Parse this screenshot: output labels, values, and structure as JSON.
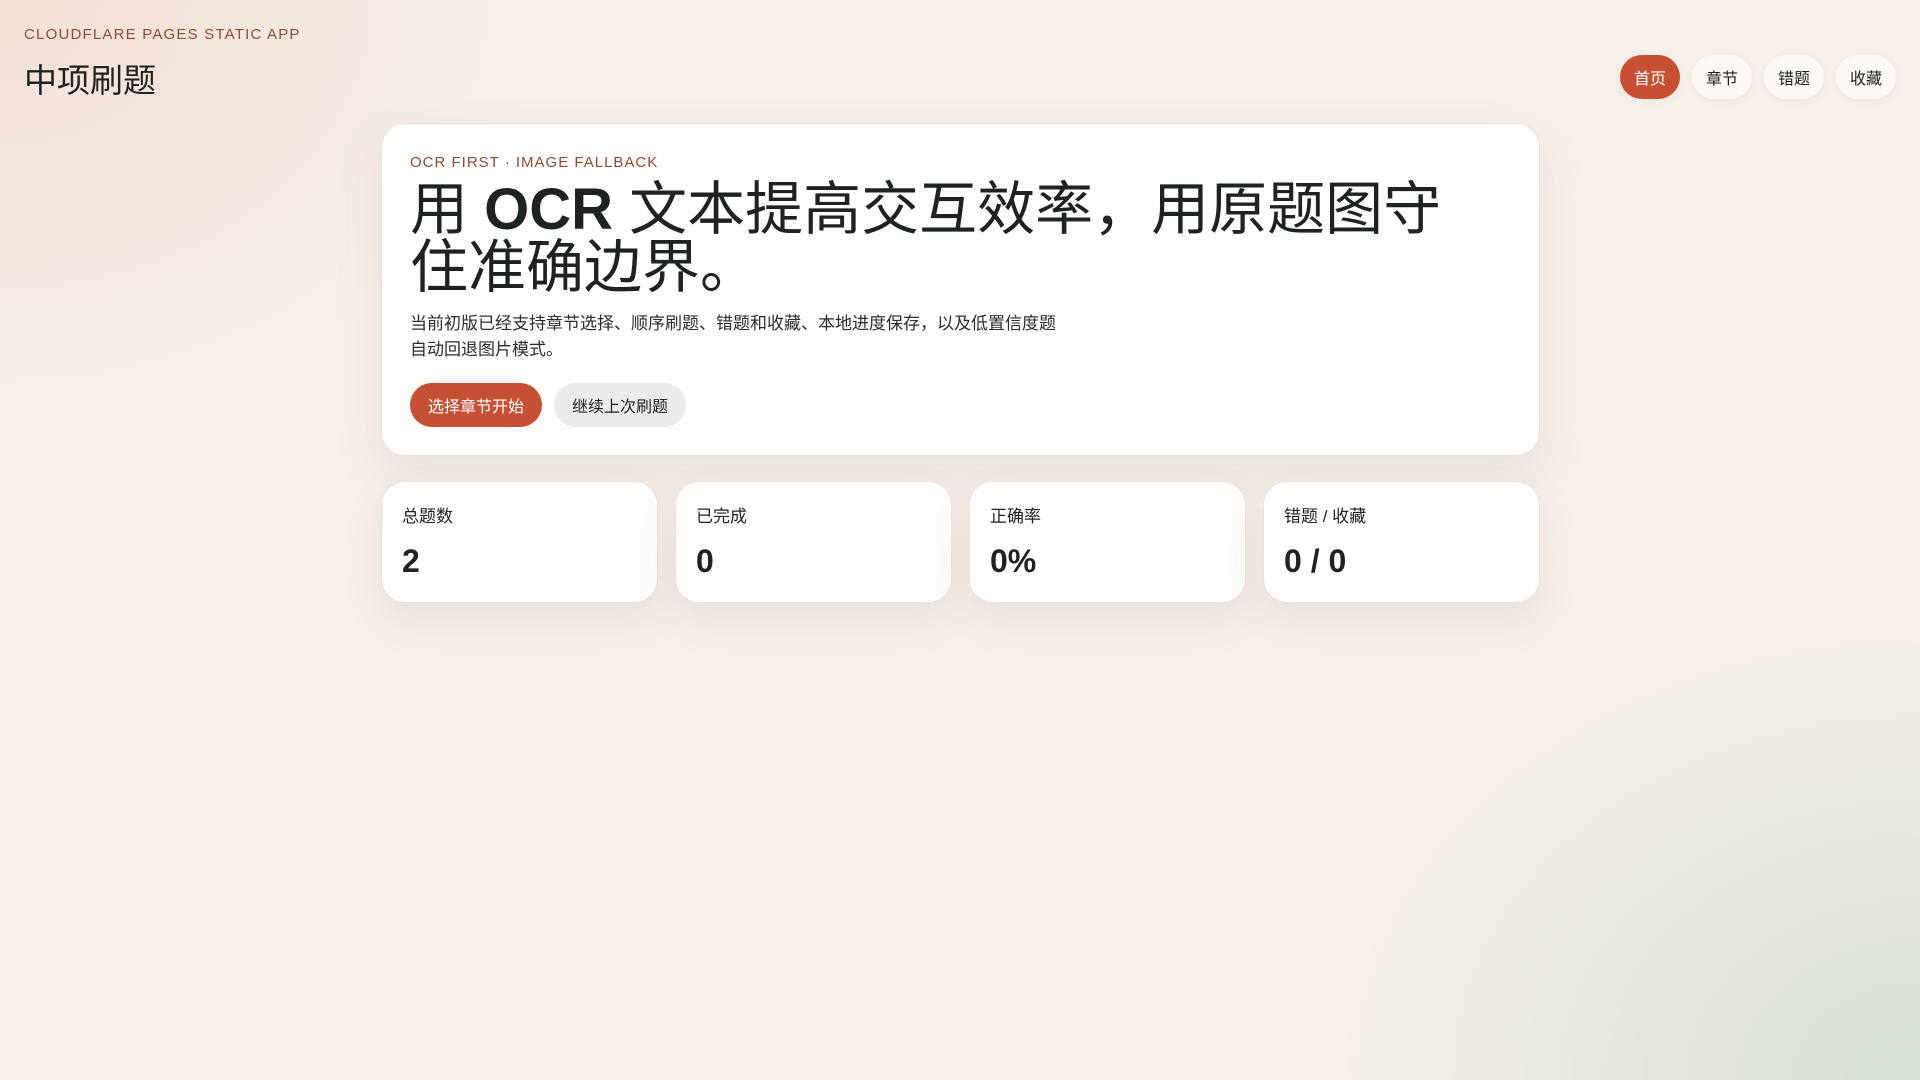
{
  "header": {
    "eyebrow": "CLOUDFLARE PAGES STATIC APP",
    "title": "中项刷题"
  },
  "nav": {
    "items": [
      {
        "label": "首页",
        "active": true
      },
      {
        "label": "章节",
        "active": false
      },
      {
        "label": "错题",
        "active": false
      },
      {
        "label": "收藏",
        "active": false
      }
    ]
  },
  "hero": {
    "eyebrow": "OCR FIRST · IMAGE FALLBACK",
    "title_prefix": "用 ",
    "title_strong": "OCR",
    "title_suffix": " 文本提高交互效率，用原题图守住准确边界。",
    "description": "当前初版已经支持章节选择、顺序刷题、错题和收藏、本地进度保存，以及低置信度题自动回退图片模式。",
    "primary_button": "选择章节开始",
    "secondary_button": "继续上次刷题"
  },
  "stats": [
    {
      "label": "总题数",
      "value": "2"
    },
    {
      "label": "已完成",
      "value": "0"
    },
    {
      "label": "正确率",
      "value": "0%"
    },
    {
      "label": "错题 / 收藏",
      "value": "0 / 0"
    }
  ],
  "colors": {
    "accent": "#c65034",
    "eyebrow": "#8f4b33",
    "text": "#1f2320"
  }
}
